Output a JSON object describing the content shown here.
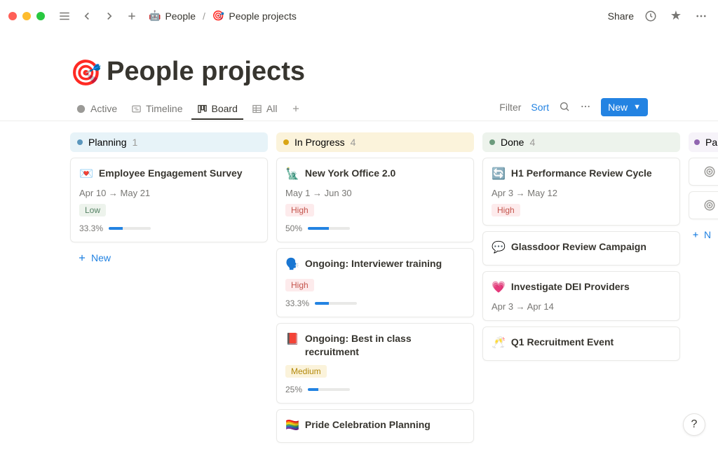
{
  "topbar": {
    "share_label": "Share",
    "breadcrumb": {
      "parent_icon": "🤖",
      "parent_label": "People",
      "current_icon": "🎯",
      "current_label": "People projects"
    }
  },
  "page": {
    "icon": "🎯",
    "title": "People projects"
  },
  "tabs": {
    "active": "Active",
    "timeline": "Timeline",
    "board": "Board",
    "all": "All"
  },
  "actions": {
    "filter": "Filter",
    "sort": "Sort",
    "new": "New"
  },
  "columns": [
    {
      "key": "planning",
      "label": "Planning",
      "count": "1",
      "new_label": "New",
      "cards": [
        {
          "emoji": "💌",
          "title": "Employee Engagement Survey",
          "dates": "Apr 10 → May 21",
          "priority": "Low",
          "priority_class": "prio-low",
          "progress_label": "33.3%",
          "progress_pct": 33.3
        }
      ]
    },
    {
      "key": "in_progress",
      "label": "In Progress",
      "count": "4",
      "cards": [
        {
          "emoji": "🗽",
          "title": "New York Office 2.0",
          "dates": "May 1 → Jun 30",
          "priority": "High",
          "priority_class": "prio-high",
          "progress_label": "50%",
          "progress_pct": 50
        },
        {
          "emoji": "🗣️",
          "title": "Ongoing: Interviewer training",
          "priority": "High",
          "priority_class": "prio-high",
          "progress_label": "33.3%",
          "progress_pct": 33.3
        },
        {
          "emoji": "📕",
          "title": "Ongoing: Best in class recruitment",
          "priority": "Medium",
          "priority_class": "prio-medium",
          "progress_label": "25%",
          "progress_pct": 25
        },
        {
          "emoji": "🏳️‍🌈",
          "title": "Pride Celebration Planning"
        }
      ]
    },
    {
      "key": "done",
      "label": "Done",
      "count": "4",
      "cards": [
        {
          "emoji": "🔄",
          "title": "H1 Performance Review Cycle",
          "dates": "Apr 3 → May 12",
          "priority": "High",
          "priority_class": "prio-high"
        },
        {
          "emoji": "💬",
          "title": "Glassdoor Review Campaign"
        },
        {
          "emoji": "💗",
          "title": "Investigate DEI Providers",
          "dates": "Apr 3 → Apr 14"
        },
        {
          "emoji": "🥂",
          "title": "Q1 Recruitment Event"
        }
      ]
    },
    {
      "key": "partial",
      "label": "Pa",
      "new_label": "N"
    }
  ],
  "help": "?"
}
